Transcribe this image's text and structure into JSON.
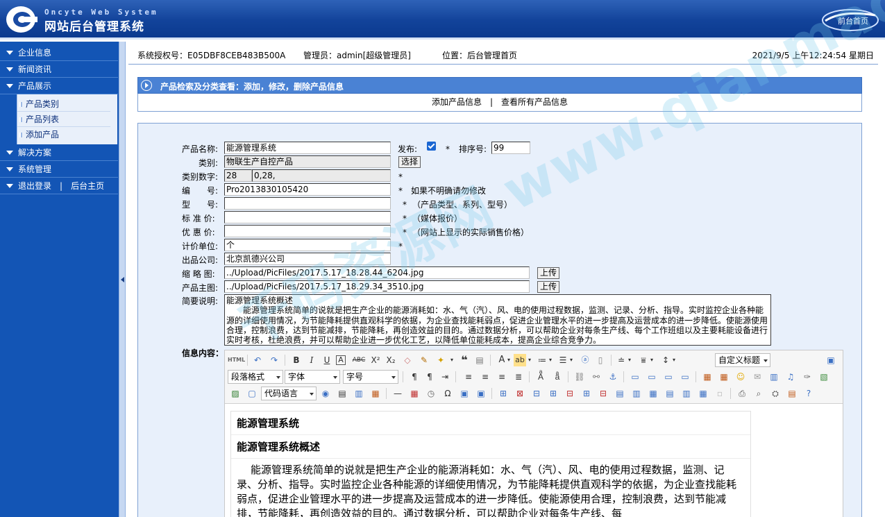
{
  "header": {
    "brand_en": "Oncyte Web System",
    "brand_cn": "网站后台管理系统",
    "home_link": "前台首页"
  },
  "sidebar": {
    "items": [
      {
        "label": "企业信息"
      },
      {
        "label": "新闻资讯"
      },
      {
        "label": "产品展示",
        "children": [
          {
            "label": "产品类别"
          },
          {
            "label": "产品列表"
          },
          {
            "label": "添加产品"
          }
        ]
      },
      {
        "label": "解决方案"
      },
      {
        "label": "系统管理"
      }
    ],
    "logout": "退出登录",
    "separator": "|",
    "back_home": "后台主页"
  },
  "infobar": {
    "license": "系统授权号：E05DBF8CEB483B500A",
    "admin": "管理员：admin[超级管理员]",
    "location": "位置：后台管理首页",
    "datetime": "2021/9/5 上午12:24:54 星期日"
  },
  "panel": {
    "title": "产品检索及分类查看：添加，修改，删除产品信息",
    "link_add": "添加产品信息",
    "link_sep": "|",
    "link_all": "查看所有产品信息"
  },
  "form": {
    "name_label": "产品名称:",
    "name_value": "能源管理系统",
    "publish_label": "发布:",
    "publish_checked": true,
    "star": "*",
    "sort_label": "排序号:",
    "sort_value": "99",
    "category_label": "类别:",
    "category_value": "物联生产自控产品",
    "select_button": "选择",
    "catnum_label": "类别数字:",
    "catnum_value1": "28",
    "catnum_value2": "0,28,",
    "code_label": "编　　号:",
    "code_value": "Pro2013830105420",
    "code_note": "如果不明确请勿修改",
    "model_label": "型　　号:",
    "model_value": "",
    "model_note": "（产品类型、系列、型号）",
    "std_price_label": "标 准 价:",
    "std_price_value": "",
    "std_price_note": "（媒体报价）",
    "sale_price_label": "优 惠 价:",
    "sale_price_value": "",
    "sale_price_note": "（网站上显示的实际销售价格）",
    "unit_label": "计价单位:",
    "unit_value": "个",
    "company_label": "出品公司:",
    "company_value": "北京凯德兴公司",
    "thumb_label": "缩 略 图:",
    "thumb_value": "../Upload/PicFiles/2017.5.17_18.28.44_6204.jpg",
    "upload_button": "上传",
    "main_img_label": "产品主图:",
    "main_img_value": "../Upload/PicFiles/2017.5.17_18.29.34_3510.jpg",
    "summary_label": "简要说明:",
    "summary_title": "能源管理系统概述",
    "summary_text": "能源管理系统简单的说就是把生产企业的能源消耗如：水、气（汽）、风、电的使用过程数据，监测、记录、分析、指导。实时监控企业各种能源的详细使用情况，为节能降耗提供直观科学的依据，为企业查找能耗弱点，促进企业管理水平的进一步提高及运营成本的进一步降低。使能源使用合理，控制浪费，达到节能减排，节能降耗，再创造效益的目的。通过数据分析，可以帮助企业对每条生产线、每个工作班组以及主要耗能设备进行实时考核，杜绝浪费，并可以帮助企业进一步优化工艺，以降低单位能耗成本，提高企业综合竞争力。",
    "content_label": "信息内容："
  },
  "editor": {
    "custom_heading": "自定义标题",
    "paragraph_format": "段落格式",
    "font_family": "字体",
    "font_size": "字号",
    "code_lang": "代码语言",
    "heading1": "能源管理系统",
    "heading2": "能源管理系统概述",
    "body_text": "能源管理系统简单的说就是把生产企业的能源消耗如：水、气（汽）、风、电的使用过程数据，监测、记录、分析、指导。实时监控企业各种能源的详细使用情况，为节能降耗提供直观科学的依据，为企业查找能耗弱点，促进企业管理水平的进一步提高及运营成本的进一步降低。使能源使用合理，控制浪费，达到节能减排，节能降耗，再创造效益的目的。通过数据分析，可以帮助企业对每条生产线、每"
  },
  "watermark": "千码资源网 www.qianmadaima.cc",
  "colors": {
    "header_blue": "#12439a",
    "sidebar_blue": "#1355b5",
    "panel_blue": "#4a82d4",
    "form_bg": "#e8f0fb"
  }
}
